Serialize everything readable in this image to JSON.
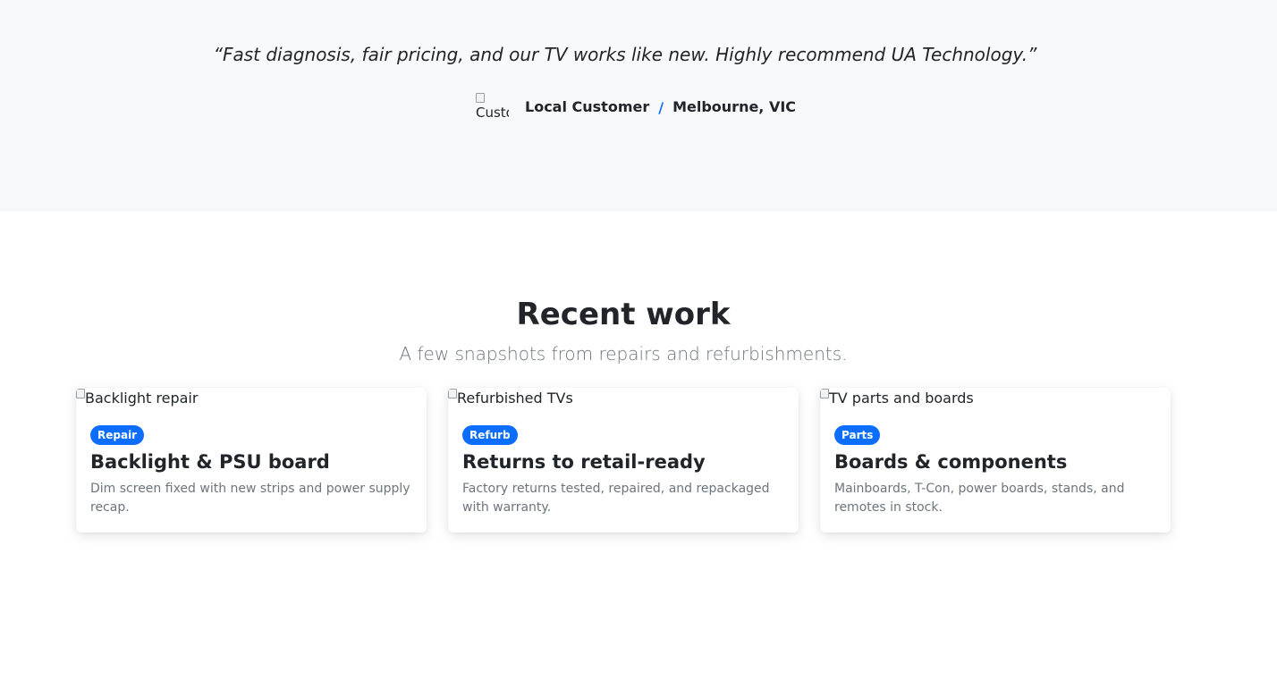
{
  "testimonial": {
    "quote": "“Fast diagnosis, fair pricing, and our TV works like new. Highly recommend UA Technology.”",
    "avatar_alt": "Customer",
    "author": "Local Customer",
    "separator": "/",
    "location": "Melbourne, VIC"
  },
  "recent_work": {
    "title": "Recent work",
    "subtitle": "A few snapshots from repairs and refurbishments.",
    "cards": [
      {
        "image_alt": "Backlight repair",
        "badge": "Repair",
        "title": "Backlight & PSU board",
        "text": "Dim screen fixed with new strips and power supply recap."
      },
      {
        "image_alt": "Refurbished TVs",
        "badge": "Refurb",
        "title": "Returns to retail-ready",
        "text": "Factory returns tested, repaired, and repackaged with warranty."
      },
      {
        "image_alt": "TV parts and boards",
        "badge": "Parts",
        "title": "Boards & components",
        "text": "Mainboards, T-Con, power boards, stands, and remotes in stock."
      }
    ]
  },
  "colors": {
    "accent": "#0d6efd",
    "testimonial_bg": "#f8f9fa",
    "muted_text": "#6c757d"
  }
}
